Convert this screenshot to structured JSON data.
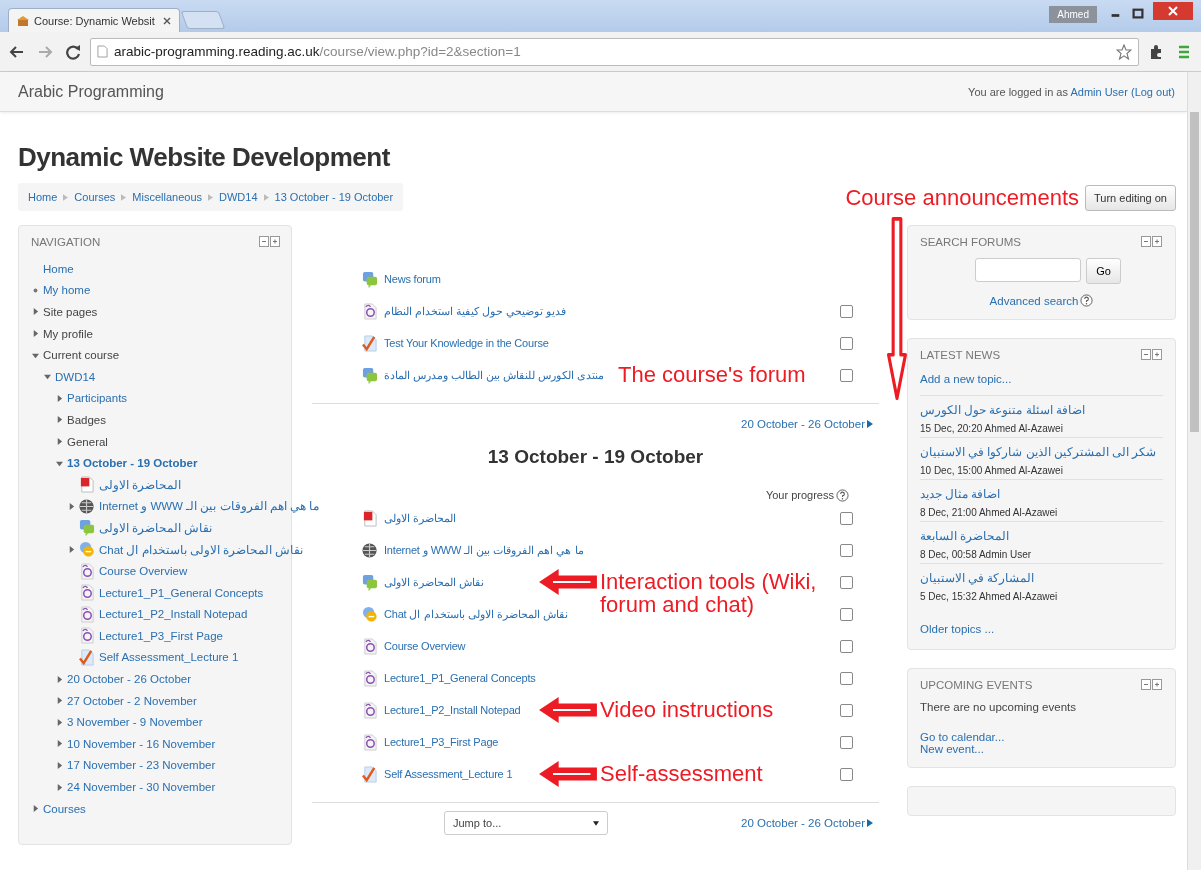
{
  "browser": {
    "tab_title": "Course: Dynamic Websit",
    "url_host": "arabic-programming.reading.ac.uk",
    "url_path": "/course/view.php?id=2&section=1",
    "user_badge": "Ahmed"
  },
  "header": {
    "site_name": "Arabic Programming",
    "login_prefix": "You are logged in as",
    "user_link": "Admin User",
    "logout_link": "(Log out)"
  },
  "page_title": "Dynamic Website Development",
  "breadcrumb": [
    "Home",
    "Courses",
    "Miscellaneous",
    "DWD14",
    "13 October - 19 October"
  ],
  "announcement_note": {
    "text": "Course announcements",
    "kind": "arrow-down"
  },
  "edit_button": "Turn editing on",
  "navigation": {
    "title": "NAVIGATION",
    "items": [
      {
        "label": "Home",
        "kind": "home",
        "link": true
      },
      {
        "label": "My home",
        "kind": "leaf",
        "link": true
      },
      {
        "label": "Site pages",
        "kind": "branch",
        "link": false,
        "expanded": false
      },
      {
        "label": "My profile",
        "kind": "branch",
        "link": false,
        "expanded": false
      },
      {
        "label": "Current course",
        "kind": "branch",
        "link": false,
        "expanded": true,
        "children": [
          {
            "label": "DWD14",
            "kind": "branch",
            "link": true,
            "expanded": true,
            "children": [
              {
                "label": "Participants",
                "kind": "branch",
                "link": true,
                "expanded": false
              },
              {
                "label": "Badges",
                "kind": "branch",
                "link": false,
                "expanded": false
              },
              {
                "label": "General",
                "kind": "branch",
                "link": false,
                "expanded": false
              },
              {
                "label": "13 October - 19 October",
                "kind": "branch",
                "link": true,
                "current": true,
                "expanded": true,
                "children": [
                  {
                    "label": "المحاضرة الاولى",
                    "kind": "pdf",
                    "link": true
                  },
                  {
                    "label": "ما هي اهم الفروقات بين الـ WWW و Internet",
                    "kind": "url",
                    "link": true,
                    "expanded": false
                  },
                  {
                    "label": "نقاش المحاضرة الاولى",
                    "kind": "forum",
                    "link": true
                  },
                  {
                    "label": "نقاش المحاضرة الاولى باستخدام ال Chat",
                    "kind": "chat",
                    "link": true,
                    "expanded": false
                  },
                  {
                    "label": "Course Overview",
                    "kind": "video",
                    "link": true
                  },
                  {
                    "label": "Lecture1_P1_General Concepts",
                    "kind": "video",
                    "link": true
                  },
                  {
                    "label": "Lecture1_P2_Install Notepad",
                    "kind": "video",
                    "link": true
                  },
                  {
                    "label": "Lecture1_P3_First Page",
                    "kind": "video",
                    "link": true
                  },
                  {
                    "label": "Self Assessment_Lecture 1",
                    "kind": "quiz",
                    "link": true
                  }
                ]
              },
              {
                "label": "20 October - 26 October",
                "kind": "branch",
                "link": true,
                "expanded": false
              },
              {
                "label": "27 October - 2 November",
                "kind": "branch",
                "link": true,
                "expanded": false
              },
              {
                "label": "3 November - 9 November",
                "kind": "branch",
                "link": true,
                "expanded": false
              },
              {
                "label": "10 November - 16 November",
                "kind": "branch",
                "link": true,
                "expanded": false
              },
              {
                "label": "17 November - 23 November",
                "kind": "branch",
                "link": true,
                "expanded": false
              },
              {
                "label": "24 November - 30 November",
                "kind": "branch",
                "link": true,
                "expanded": false
              }
            ]
          }
        ]
      },
      {
        "label": "Courses",
        "kind": "branch",
        "link": true,
        "expanded": false
      }
    ]
  },
  "course": {
    "top_items": [
      {
        "label": "News forum",
        "kind": "forum"
      },
      {
        "label": "فديو توضيحي حول كيفية استخدام النظام",
        "kind": "video",
        "checked": false
      },
      {
        "label": "Test Your Knowledge in the Course",
        "kind": "quiz",
        "checked": false
      },
      {
        "label": "منتدى الكورس للنقاش بين الطالب ومدرس المادة",
        "kind": "forum",
        "checked": false,
        "annotation": {
          "text": "The course's forum",
          "kind": "plain"
        }
      }
    ],
    "next_link": "20 October - 26 October",
    "section_title": "13 October - 19 October",
    "progress_label": "Your progress",
    "items": [
      {
        "label": "المحاضرة الاولى",
        "kind": "pdf",
        "checked": false
      },
      {
        "label": "ما هي اهم الفروقات بين الـ WWW و Internet",
        "kind": "url",
        "checked": false
      },
      {
        "label": "نقاش المحاضرة الاولى",
        "kind": "forum",
        "checked": false,
        "annotation": {
          "text": "Interaction tools (Wiki, forum and chat)",
          "kind": "arrow-left"
        }
      },
      {
        "label": "نقاش المحاضرة الاولى باستخدام ال Chat",
        "kind": "chat",
        "checked": false
      },
      {
        "label": "Course Overview",
        "kind": "video",
        "checked": false
      },
      {
        "label": "Lecture1_P1_General Concepts",
        "kind": "video",
        "checked": false
      },
      {
        "label": "Lecture1_P2_Install Notepad",
        "kind": "video",
        "checked": false,
        "annotation": {
          "text": "Video instructions",
          "kind": "arrow-left"
        }
      },
      {
        "label": "Lecture1_P3_First Page",
        "kind": "video",
        "checked": false
      },
      {
        "label": "Self Assessment_Lecture 1",
        "kind": "quiz",
        "checked": false,
        "annotation": {
          "text": "Self-assessment",
          "kind": "arrow-left"
        }
      }
    ],
    "jump_placeholder": "Jump to...",
    "bottom_next_link": "20 October - 26 October"
  },
  "search_forums": {
    "title": "SEARCH FORUMS",
    "button": "Go",
    "advanced_link": "Advanced search"
  },
  "latest_news": {
    "title": "LATEST NEWS",
    "add_link": "Add a new topic...",
    "items": [
      {
        "title": "اضافة اسئلة متنوعة حول الكورس",
        "meta": "15 Dec, 20:20 Ahmed Al-Azawei"
      },
      {
        "title": "شكر الى المشتركين الذين شاركوا في الاستبيان",
        "meta": "10 Dec, 15:00 Ahmed Al-Azawei"
      },
      {
        "title": "اضافة مثال جديد",
        "meta": "8 Dec, 21:00 Ahmed Al-Azawei"
      },
      {
        "title": "المحاضرة السابعة",
        "meta": "8 Dec, 00:58 Admin User"
      },
      {
        "title": "المشاركة في الاستبيان",
        "meta": "5 Dec, 15:32 Ahmed Al-Azawei"
      }
    ],
    "older_link": "Older topics ..."
  },
  "upcoming_events": {
    "title": "UPCOMING EVENTS",
    "empty_text": "There are no upcoming events",
    "calendar_link": "Go to calendar...",
    "new_event_link": "New event..."
  }
}
